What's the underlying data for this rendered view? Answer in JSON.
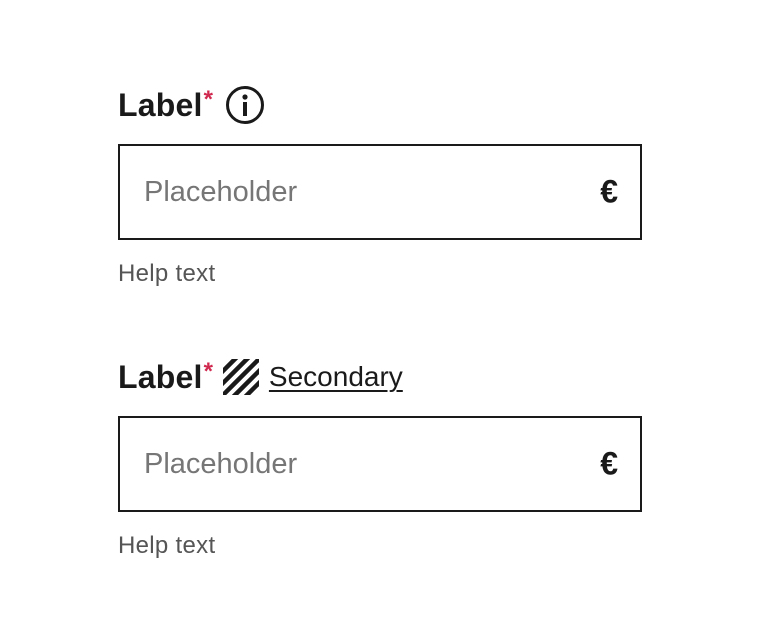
{
  "fields": [
    {
      "label": "Label",
      "required_mark": "*",
      "label_accessory": "info-icon",
      "input": {
        "placeholder": "Placeholder",
        "value": ""
      },
      "currency_symbol": "€",
      "help_text": "Help text"
    },
    {
      "label": "Label",
      "required_mark": "*",
      "label_accessory": "hatch-icon",
      "secondary_link": "Secondary",
      "input": {
        "placeholder": "Placeholder",
        "value": ""
      },
      "currency_symbol": "€",
      "help_text": "Help text"
    }
  ],
  "colors": {
    "text": "#1a1a1a",
    "required": "#d0294f",
    "placeholder": "#767676",
    "help": "#555555",
    "border": "#1a1a1a"
  }
}
